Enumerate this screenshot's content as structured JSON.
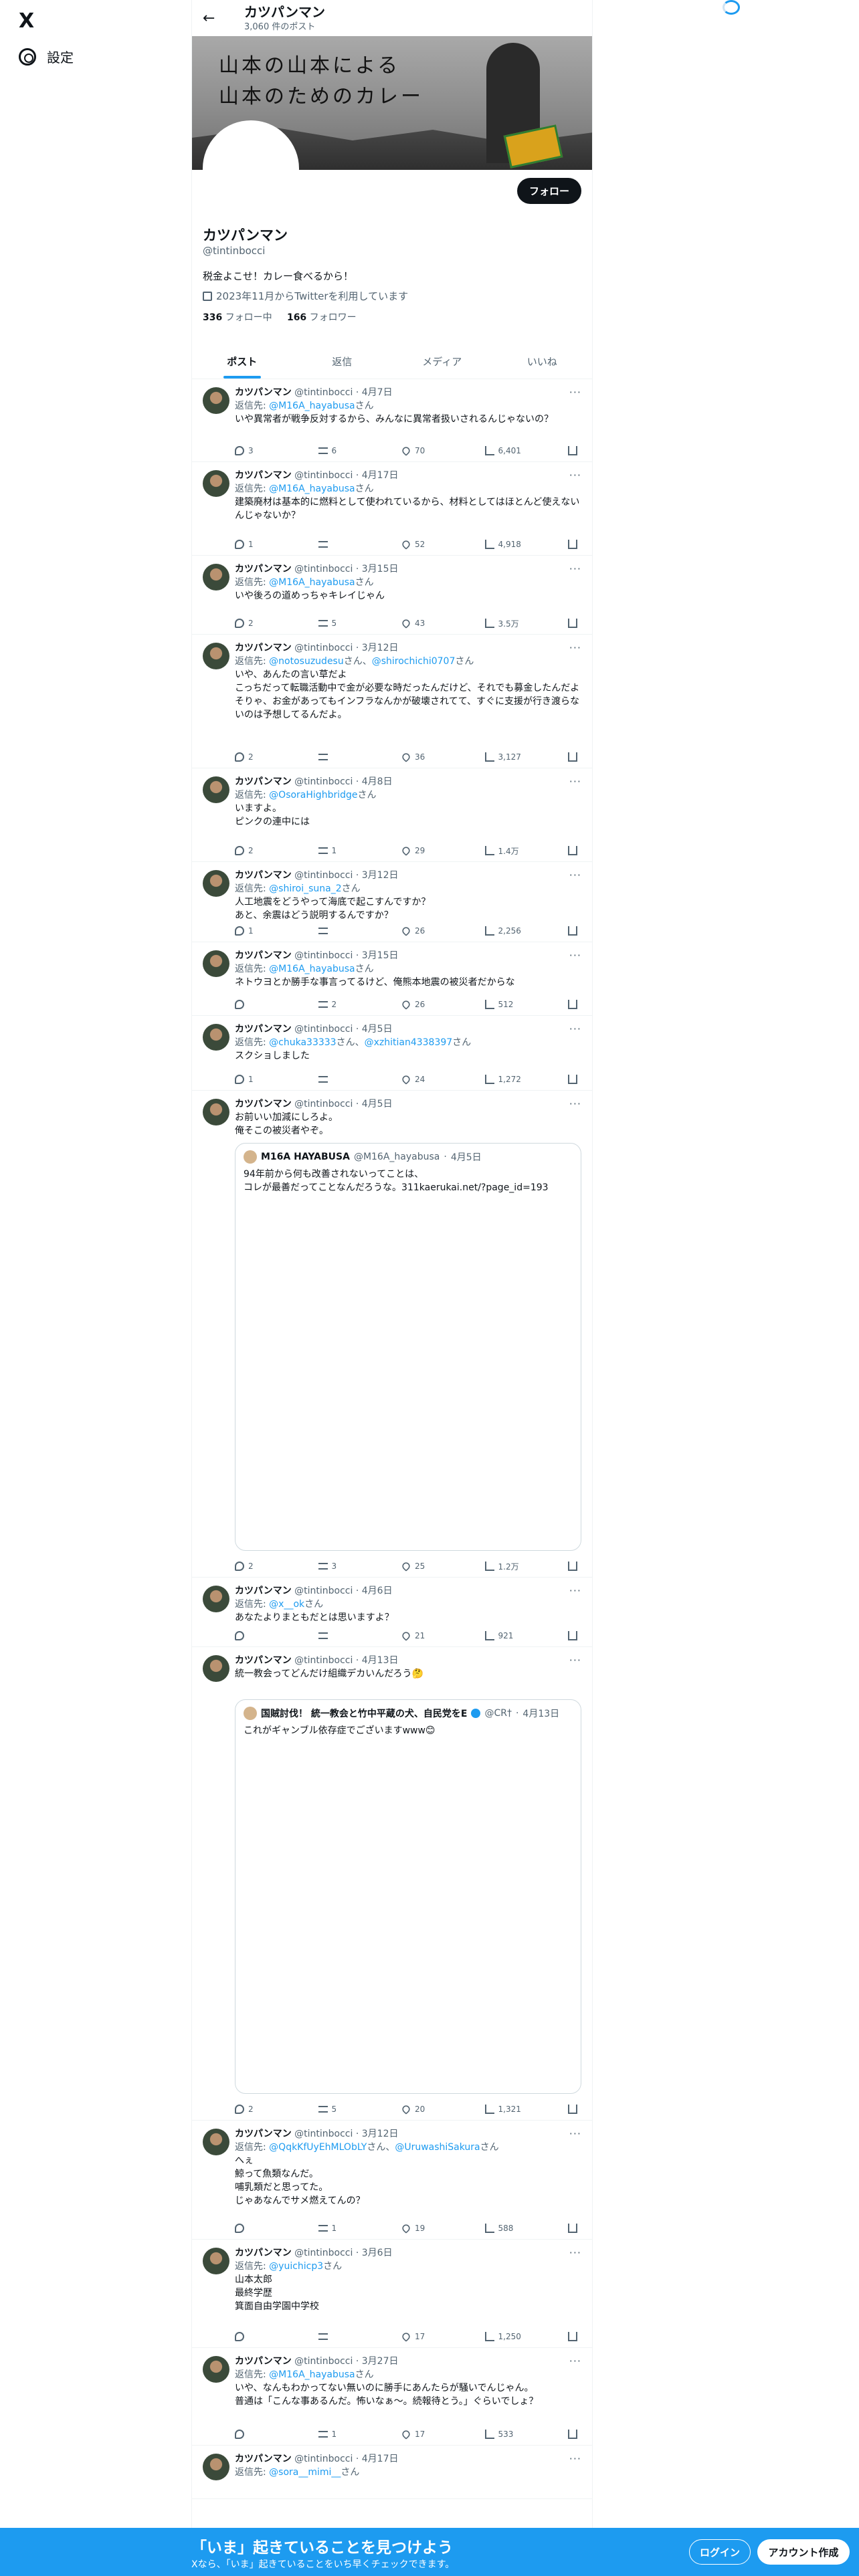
{
  "nav": {
    "logo": "X",
    "settings_label": "設定"
  },
  "header": {
    "name": "カツパンマン",
    "post_count": "3,060 件のポスト"
  },
  "banner": {
    "text_line1": "山本の山本による",
    "text_line2": "山本のためのカレー"
  },
  "profile": {
    "follow_label": "フォロー",
    "name": "カツパンマン",
    "handle": "@tintinbocci",
    "bio": "税金よこせ！カレー食べるから！",
    "joined": "2023年11月からTwitterを利用しています",
    "following_count": "336",
    "following_label": "フォロー中",
    "followers_count": "166",
    "followers_label": "フォロワー"
  },
  "tabs": [
    "ポスト",
    "返信",
    "メディア",
    "いいね"
  ],
  "tweets": [
    {
      "name": "カツパンマン",
      "handle": "@tintinbocci",
      "date": "4月7日",
      "reply_prefix": "返信先: ",
      "reply_to": "@M16A_hayabusa",
      "reply_suffix": "さん",
      "text": "いや異常者が戦争反対するから、みんなに異常者扱いされるんじゃないの？",
      "replies": "3",
      "retweets": "6",
      "likes": "70",
      "views": "6,401"
    },
    {
      "name": "カツパンマン",
      "handle": "@tintinbocci",
      "date": "4月17日",
      "reply_prefix": "返信先: ",
      "reply_to": "@M16A_hayabusa",
      "reply_suffix": "さん",
      "text": "建築廃材は基本的に燃料として使われているから、材料としてはほとんど使えないんじゃないか？",
      "replies": "1",
      "retweets": "",
      "likes": "52",
      "views": "4,918"
    },
    {
      "name": "カツパンマン",
      "handle": "@tintinbocci",
      "date": "3月15日",
      "reply_prefix": "返信先: ",
      "reply_to": "@M16A_hayabusa",
      "reply_suffix": "さん",
      "text": "いや後ろの道めっちゃキレイじゃん",
      "replies": "2",
      "retweets": "5",
      "likes": "43",
      "views": "3.5万"
    },
    {
      "name": "カツパンマン",
      "handle": "@tintinbocci",
      "date": "3月12日",
      "reply_prefix": "返信先: ",
      "reply_to": "@notosuzudesu",
      "reply_mid": "さん、",
      "reply_to2": "@shirochichi0707",
      "reply_suffix": "さん",
      "text": "いや、あんたの言い草だよ\nこっちだって転職活動中で金が必要な時だったんだけど、それでも募金したんだよ\nそりゃ、お金があってもインフラなんかが破壊されてて、すぐに支援が行き渡らないのは予想してるんだよ。",
      "replies": "2",
      "retweets": "",
      "likes": "36",
      "views": "3,127"
    },
    {
      "name": "カツパンマン",
      "handle": "@tintinbocci",
      "date": "4月8日",
      "reply_prefix": "返信先: ",
      "reply_to": "@OsoraHighbridge",
      "reply_suffix": "さん",
      "text": "いますよ。\nピンクの連中には",
      "replies": "2",
      "retweets": "1",
      "likes": "29",
      "views": "1.4万"
    },
    {
      "name": "カツパンマン",
      "handle": "@tintinbocci",
      "date": "3月12日",
      "reply_prefix": "返信先: ",
      "reply_to": "@shiroi_suna_2",
      "reply_suffix": "さん",
      "text": "人工地震をどうやって海底で起こすんですか？\nあと、余震はどう説明するんですか？",
      "replies": "1",
      "retweets": "",
      "likes": "26",
      "views": "2,256"
    },
    {
      "name": "カツパンマン",
      "handle": "@tintinbocci",
      "date": "3月15日",
      "reply_prefix": "返信先: ",
      "reply_to": "@M16A_hayabusa",
      "reply_suffix": "さん",
      "text": "ネトウヨとか勝手な事言ってるけど、俺熊本地震の被災者だからな",
      "replies": "",
      "retweets": "2",
      "likes": "26",
      "views": "512"
    },
    {
      "name": "カツパンマン",
      "handle": "@tintinbocci",
      "date": "4月5日",
      "reply_prefix": "返信先: ",
      "reply_to": "@chuka33333",
      "reply_mid": "さん、",
      "reply_to2": "@xzhitian4338397",
      "reply_suffix": "さん",
      "text": "スクショしました",
      "replies": "1",
      "retweets": "",
      "likes": "24",
      "views": "1,272"
    },
    {
      "name": "カツパンマン",
      "handle": "@tintinbocci",
      "date": "4月5日",
      "text": "お前いい加減にしろよ。\n俺そこの被災者やぞ。",
      "replies": "2",
      "retweets": "3",
      "likes": "25",
      "views": "1.2万",
      "quote": {
        "name": "M16A HAYABUSA",
        "handle": "@M16A_hayabusa",
        "date": "4月5日",
        "text": "94年前から何も改善されないってことは、\nコレが最善だってことなんだろうな。311kaerukai.net/?page_id=193"
      }
    },
    {
      "name": "カツパンマン",
      "handle": "@tintinbocci",
      "date": "4月6日",
      "reply_prefix": "返信先: ",
      "reply_to": "@x__ok",
      "reply_suffix": "さん",
      "text": "あなたよりまともだとは思いますよ？",
      "replies": "",
      "retweets": "",
      "likes": "21",
      "views": "921"
    },
    {
      "name": "カツパンマン",
      "handle": "@tintinbocci",
      "date": "4月13日",
      "text": "統一教会ってどんだけ組織デカいんだろう🤔",
      "replies": "2",
      "retweets": "5",
      "likes": "20",
      "views": "1,321",
      "quote": {
        "name": "国賊討伐！ 統一教会と竹中平蔵の犬、自民党をE",
        "handle": "@CR†",
        "date": "4月13日",
        "text": "これがギャンブル依存症でございますwww😊"
      }
    },
    {
      "name": "カツパンマン",
      "handle": "@tintinbocci",
      "date": "3月12日",
      "reply_prefix": "返信先: ",
      "reply_to": "@QqkKfUyEhMLObLY",
      "reply_mid": "さん、",
      "reply_to2": "@UruwashiSakura",
      "reply_suffix": "さん",
      "text": "へぇ\n鯨って魚類なんだ。\n哺乳類だと思ってた。\nじゃあなんでサメ燃えてんの？",
      "replies": "",
      "retweets": "1",
      "likes": "19",
      "views": "588"
    },
    {
      "name": "カツパンマン",
      "handle": "@tintinbocci",
      "date": "3月6日",
      "reply_prefix": "返信先: ",
      "reply_to": "@yuichicp3",
      "reply_suffix": "さん",
      "text": "山本太郎\n最終学歴\n箕面自由学園中学校",
      "replies": "",
      "retweets": "",
      "likes": "17",
      "views": "1,250"
    },
    {
      "name": "カツパンマン",
      "handle": "@tintinbocci",
      "date": "3月27日",
      "reply_prefix": "返信先: ",
      "reply_to": "@M16A_hayabusa",
      "reply_suffix": "さん",
      "text": "いや、なんもわかってない無いのに勝手にあんたらが騒いでんじゃん。\n普通は「こんな事あるんだ。怖いなぁ〜。続報待とう。」ぐらいでしょ？",
      "replies": "",
      "retweets": "1",
      "likes": "17",
      "views": "533"
    },
    {
      "name": "カツパンマン",
      "handle": "@tintinbocci",
      "date": "4月17日",
      "reply_prefix": "返信先: ",
      "reply_to": "@sora__mimi__",
      "reply_suffix": "さん",
      "text": "",
      "replies": "",
      "retweets": "",
      "likes": "",
      "views": ""
    }
  ],
  "bottom_bar": {
    "title": "「いま」起きていることを見つけよう",
    "subtitle": "Xなら、「いま」起きていることをいち早くチェックできます。",
    "login_label": "ログイン",
    "signup_label": "アカウント作成"
  },
  "colors": {
    "accent": "#1d9bf0",
    "text": "#0f1419",
    "muted": "#536471"
  }
}
